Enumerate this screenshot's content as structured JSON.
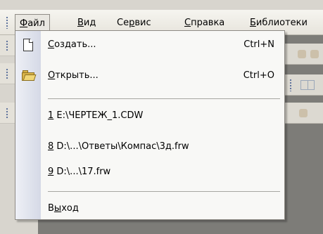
{
  "menubar": {
    "items": [
      {
        "underline": "Ф",
        "rest": "айл"
      },
      {
        "underline": "В",
        "rest": "ид"
      },
      {
        "pre": "Се",
        "underline": "р",
        "rest": "вис"
      },
      {
        "underline": "С",
        "rest": "правка"
      },
      {
        "underline": "Б",
        "rest": "иблиотеки"
      }
    ]
  },
  "file_menu": {
    "create": {
      "underline": "С",
      "rest": "оздать...",
      "shortcut": "Ctrl+N"
    },
    "open": {
      "underline": "О",
      "rest": "ткрыть...",
      "shortcut": "Ctrl+O"
    },
    "recent": [
      {
        "underline": "1",
        "rest": " E:\\ЧЕРТЕЖ_1.CDW"
      },
      {
        "underline": "8",
        "rest": " D:\\...\\Ответы\\Компас\\3д.frw"
      },
      {
        "underline": "9",
        "rest": " D:\\...\\17.frw"
      }
    ],
    "exit": {
      "pre": "В",
      "underline": "ы",
      "rest": "ход"
    }
  },
  "icons": {
    "create": "new-document-icon",
    "open": "open-folder-icon"
  },
  "colors": {
    "menu_background": "#f8f8f6",
    "icon_gutter": "#d5d9e6",
    "menubar": "#e7e4dc",
    "workspace": "#7d7c78"
  }
}
